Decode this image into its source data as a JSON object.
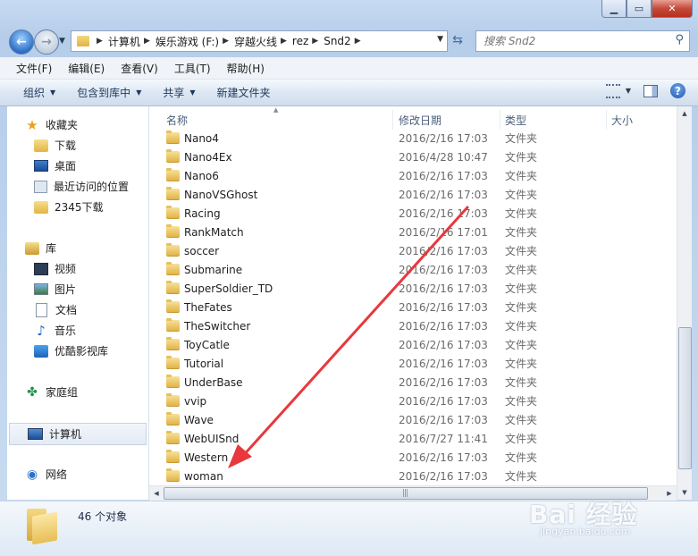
{
  "address": {
    "crumbs": [
      "计算机",
      "娱乐游戏 (F:)",
      "穿越火线",
      "rez",
      "Snd2"
    ]
  },
  "search": {
    "placeholder": "搜索 Snd2"
  },
  "menu": [
    "文件(F)",
    "编辑(E)",
    "查看(V)",
    "工具(T)",
    "帮助(H)"
  ],
  "commands": {
    "organize": "组织",
    "include_library": "包含到库中",
    "share": "共享",
    "new_folder": "新建文件夹"
  },
  "nav": {
    "favorites": {
      "label": "收藏夹",
      "items": [
        "下载",
        "桌面",
        "最近访问的位置",
        "2345下载"
      ]
    },
    "libraries": {
      "label": "库",
      "items": [
        "视频",
        "图片",
        "文档",
        "音乐",
        "优酷影视库"
      ]
    },
    "homegroup": "家庭组",
    "computer": "计算机",
    "network": "网络"
  },
  "columns": {
    "name": "名称",
    "date": "修改日期",
    "type": "类型",
    "size": "大小"
  },
  "files": [
    {
      "name": "Nano4",
      "date": "2016/2/16 17:03",
      "type": "文件夹"
    },
    {
      "name": "Nano4Ex",
      "date": "2016/4/28 10:47",
      "type": "文件夹"
    },
    {
      "name": "Nano6",
      "date": "2016/2/16 17:03",
      "type": "文件夹"
    },
    {
      "name": "NanoVSGhost",
      "date": "2016/2/16 17:03",
      "type": "文件夹"
    },
    {
      "name": "Racing",
      "date": "2016/2/16 17:03",
      "type": "文件夹"
    },
    {
      "name": "RankMatch",
      "date": "2016/2/16 17:01",
      "type": "文件夹"
    },
    {
      "name": "soccer",
      "date": "2016/2/16 17:03",
      "type": "文件夹"
    },
    {
      "name": "Submarine",
      "date": "2016/2/16 17:03",
      "type": "文件夹"
    },
    {
      "name": "SuperSoldier_TD",
      "date": "2016/2/16 17:03",
      "type": "文件夹"
    },
    {
      "name": "TheFates",
      "date": "2016/2/16 17:03",
      "type": "文件夹"
    },
    {
      "name": "TheSwitcher",
      "date": "2016/2/16 17:03",
      "type": "文件夹"
    },
    {
      "name": "ToyCatle",
      "date": "2016/2/16 17:03",
      "type": "文件夹"
    },
    {
      "name": "Tutorial",
      "date": "2016/2/16 17:03",
      "type": "文件夹"
    },
    {
      "name": "UnderBase",
      "date": "2016/2/16 17:03",
      "type": "文件夹"
    },
    {
      "name": "vvip",
      "date": "2016/2/16 17:03",
      "type": "文件夹"
    },
    {
      "name": "Wave",
      "date": "2016/2/16 17:03",
      "type": "文件夹"
    },
    {
      "name": "WebUISnd",
      "date": "2016/7/27 11:41",
      "type": "文件夹"
    },
    {
      "name": "Western",
      "date": "2016/2/16 17:03",
      "type": "文件夹"
    },
    {
      "name": "woman",
      "date": "2016/2/16 17:03",
      "type": "文件夹"
    }
  ],
  "status": {
    "count": "46 个对象"
  },
  "watermark": {
    "main": "Bai 经验",
    "sub": "jingyan.baidu.com"
  },
  "colors": {
    "annotation_arrow": "#e8383d",
    "selection": "#e3ebf5"
  }
}
